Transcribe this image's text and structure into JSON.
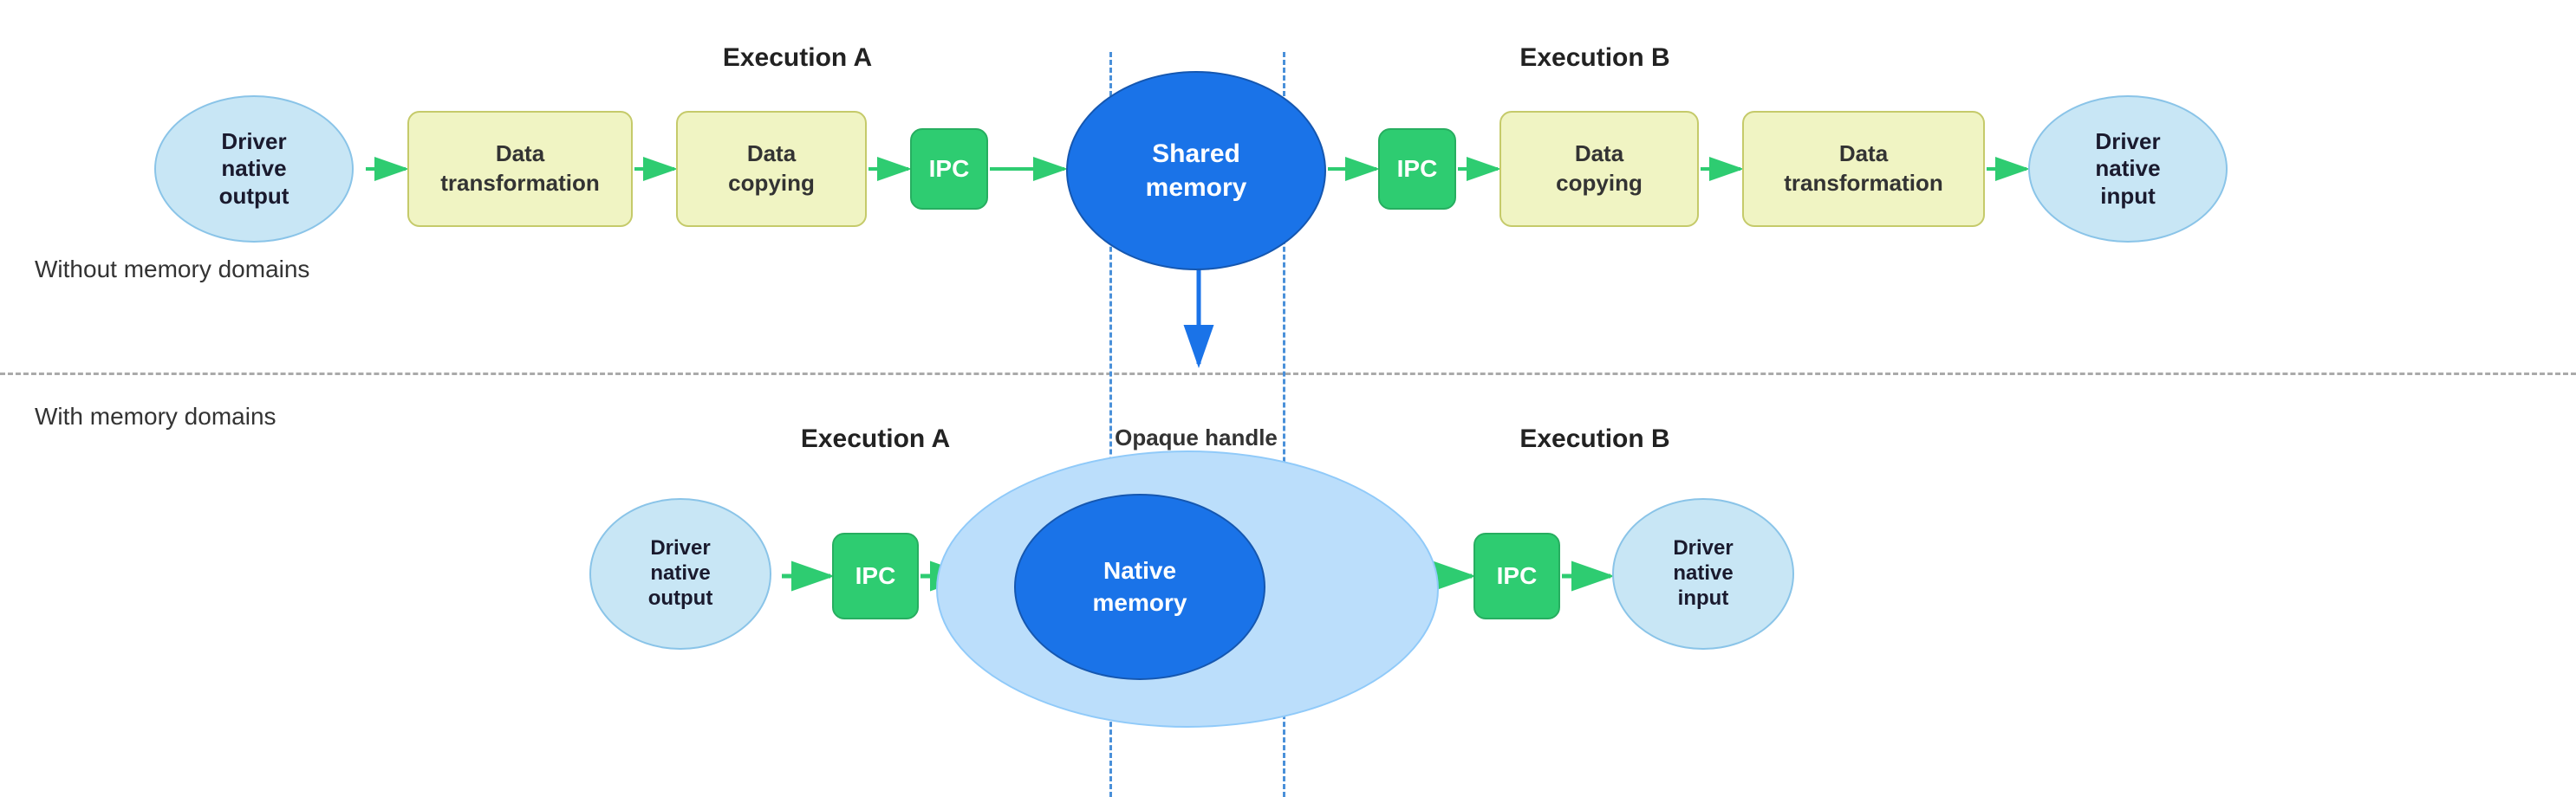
{
  "sections": {
    "without": "Without memory domains",
    "with": "With memory domains"
  },
  "top_row": {
    "exec_a_label": "Execution A",
    "exec_b_label": "Execution B",
    "nodes": [
      {
        "id": "driver_out_top",
        "label": "Driver\nnative\noutput",
        "type": "oval-light-blue"
      },
      {
        "id": "data_trans1",
        "label": "Data\ntransformation",
        "type": "rect-yellow"
      },
      {
        "id": "data_copy1",
        "label": "Data\ncopying",
        "type": "rect-yellow"
      },
      {
        "id": "ipc1",
        "label": "IPC",
        "type": "rect-green"
      },
      {
        "id": "shared_mem",
        "label": "Shared\nmemory",
        "type": "circle-blue"
      },
      {
        "id": "ipc2",
        "label": "IPC",
        "type": "rect-green"
      },
      {
        "id": "data_copy2",
        "label": "Data\ncopying",
        "type": "rect-yellow"
      },
      {
        "id": "data_trans2",
        "label": "Data\ntransformation",
        "type": "rect-yellow"
      },
      {
        "id": "driver_in_top",
        "label": "Driver\nnative\ninput",
        "type": "oval-light-blue"
      }
    ]
  },
  "bottom_row": {
    "exec_a_label": "Execution A",
    "exec_b_label": "Execution B",
    "opaque_label": "Opaque handle",
    "nodes": [
      {
        "id": "driver_out_bot",
        "label": "Driver\nnative\noutput",
        "type": "oval-light-blue"
      },
      {
        "id": "ipc3",
        "label": "IPC",
        "type": "rect-green"
      },
      {
        "id": "native_mem",
        "label": "Native\nmemory",
        "type": "circle-blue"
      },
      {
        "id": "ipc4",
        "label": "IPC",
        "type": "rect-green"
      },
      {
        "id": "driver_in_bot",
        "label": "Driver\nnative\ninput",
        "type": "oval-light-blue"
      }
    ]
  },
  "colors": {
    "light_blue_oval_bg": "#c8e6f5",
    "light_blue_oval_border": "#8ac4e8",
    "yellow_rect_bg": "#f0f4c3",
    "yellow_rect_border": "#c5ca6a",
    "green_rect_bg": "#2ecc71",
    "green_rect_border": "#27ae60",
    "blue_circle_bg": "#1a73e8",
    "blue_circle_border": "#1557b0",
    "opaque_bg": "#bbdefb",
    "opaque_border": "#90caf9",
    "arrow_green": "#2ecc71",
    "arrow_blue": "#1a73e8",
    "vline_color": "#4a90d9"
  }
}
